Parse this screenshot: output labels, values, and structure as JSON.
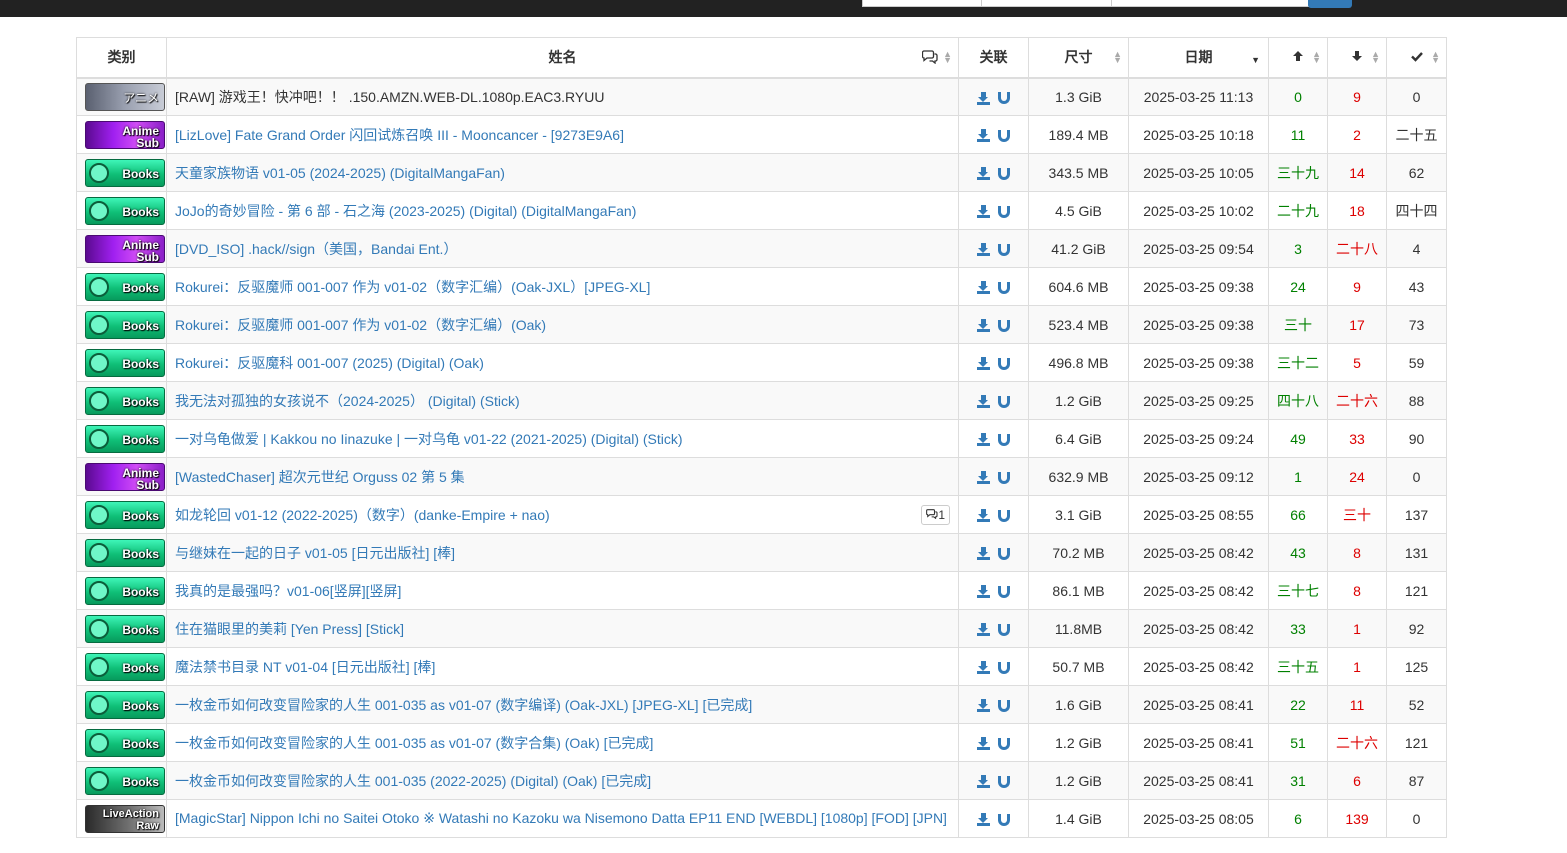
{
  "colors": {
    "accent": "#337ab7",
    "seeders": "#008000",
    "leechers": "#dd0000",
    "topbar": "#222222"
  },
  "table": {
    "headers": {
      "category": "类别",
      "name": "姓名",
      "comments_icon": "comments-icon",
      "links": "关联",
      "size": "尺寸",
      "date": "日期",
      "seeders_icon": "arrow-up-icon",
      "leechers_icon": "arrow-down-icon",
      "completed_icon": "check-icon"
    },
    "rows": [
      {
        "category": "アニメ",
        "cat_class": "cat-raw",
        "name": "[RAW] 游戏王！快冲吧！！ .150.AMZN.WEB-DL.1080p.EAC3.RYUU",
        "comments": "",
        "size": "1.3 GiB",
        "date": "2025-03-25 11:13",
        "seeders": "0",
        "leechers": "9",
        "completed": "0"
      },
      {
        "category": "Anime Sub",
        "cat_class": "cat-sub",
        "name": "[LizLove] Fate Grand Order 闪回试炼召唤 III - Mooncancer - [9273E9A6]",
        "comments": "",
        "size": "189.4 MB",
        "date": "2025-03-25 10:18",
        "seeders": "11",
        "leechers": "2",
        "completed": "二十五"
      },
      {
        "category": "Books",
        "cat_class": "cat-books",
        "name": "天童家族物语 v01-05 (2024-2025) (DigitalMangaFan)",
        "comments": "",
        "size": "343.5 MB",
        "date": "2025-03-25 10:05",
        "seeders": "三十九",
        "leechers": "14",
        "completed": "62"
      },
      {
        "category": "Books",
        "cat_class": "cat-books",
        "name": "JoJo的奇妙冒险 - 第 6 部 - 石之海 (2023-2025) (Digital) (DigitalMangaFan)",
        "comments": "",
        "size": "4.5 GiB",
        "date": "2025-03-25 10:02",
        "seeders": "二十九",
        "leechers": "18",
        "completed": "四十四"
      },
      {
        "category": "Anime Sub",
        "cat_class": "cat-sub",
        "name": "[DVD_ISO] .hack//sign（美国，Bandai Ent.）",
        "comments": "",
        "size": "41.2 GiB",
        "date": "2025-03-25 09:54",
        "seeders": "3",
        "leechers": "二十八",
        "completed": "4"
      },
      {
        "category": "Books",
        "cat_class": "cat-books",
        "name": "Rokurei：反驱魔师 001-007 作为 v01-02（数字汇编）(Oak-JXL）[JPEG-XL]",
        "comments": "",
        "size": "604.6 MB",
        "date": "2025-03-25 09:38",
        "seeders": "24",
        "leechers": "9",
        "completed": "43"
      },
      {
        "category": "Books",
        "cat_class": "cat-books",
        "name": "Rokurei：反驱魔师 001-007 作为 v01-02（数字汇编）(Oak)",
        "comments": "",
        "size": "523.4 MB",
        "date": "2025-03-25 09:38",
        "seeders": "三十",
        "leechers": "17",
        "completed": "73"
      },
      {
        "category": "Books",
        "cat_class": "cat-books",
        "name": "Rokurei：反驱魔科 001-007 (2025) (Digital) (Oak)",
        "comments": "",
        "size": "496.8 MB",
        "date": "2025-03-25 09:38",
        "seeders": "三十二",
        "leechers": "5",
        "completed": "59"
      },
      {
        "category": "Books",
        "cat_class": "cat-books",
        "name": "我无法对孤独的女孩说不（2024-2025） (Digital) (Stick)",
        "comments": "",
        "size": "1.2 GiB",
        "date": "2025-03-25 09:25",
        "seeders": "四十八",
        "leechers": "二十六",
        "completed": "88"
      },
      {
        "category": "Books",
        "cat_class": "cat-books",
        "name": "一对乌龟做爱 | Kakkou no Iinazuke | 一对乌龟 v01-22 (2021-2025) (Digital) (Stick)",
        "comments": "",
        "size": "6.4 GiB",
        "date": "2025-03-25 09:24",
        "seeders": "49",
        "leechers": "33",
        "completed": "90"
      },
      {
        "category": "Anime Sub",
        "cat_class": "cat-sub",
        "name": "[WastedChaser] 超次元世纪 Orguss 02 第 5 集",
        "comments": "",
        "size": "632.9 MB",
        "date": "2025-03-25 09:12",
        "seeders": "1",
        "leechers": "24",
        "completed": "0"
      },
      {
        "category": "Books",
        "cat_class": "cat-books",
        "name": "如龙轮回 v01-12 (2022-2025)（数字）(danke-Empire + nao)",
        "comments": "1",
        "size": "3.1 GiB",
        "date": "2025-03-25 08:55",
        "seeders": "66",
        "leechers": "三十",
        "completed": "137"
      },
      {
        "category": "Books",
        "cat_class": "cat-books",
        "name": "与继妹在一起的日子 v01-05 [日元出版社] [棒]",
        "comments": "",
        "size": "70.2 MB",
        "date": "2025-03-25 08:42",
        "seeders": "43",
        "leechers": "8",
        "completed": "131"
      },
      {
        "category": "Books",
        "cat_class": "cat-books",
        "name": "我真的是最强吗？v01-06[竖屏][竖屏]",
        "comments": "",
        "size": "86.1 MB",
        "date": "2025-03-25 08:42",
        "seeders": "三十七",
        "leechers": "8",
        "completed": "121"
      },
      {
        "category": "Books",
        "cat_class": "cat-books",
        "name": "住在猫眼里的美莉 [Yen Press] [Stick]",
        "comments": "",
        "size": "11.8MB",
        "date": "2025-03-25 08:42",
        "seeders": "33",
        "leechers": "1",
        "completed": "92"
      },
      {
        "category": "Books",
        "cat_class": "cat-books",
        "name": "魔法禁书目录 NT v01-04 [日元出版社] [棒]",
        "comments": "",
        "size": "50.7 MB",
        "date": "2025-03-25 08:42",
        "seeders": "三十五",
        "leechers": "1",
        "completed": "125"
      },
      {
        "category": "Books",
        "cat_class": "cat-books",
        "name": "一枚金币如何改变冒险家的人生 001-035 as v01-07 (数字编译) (Oak-JXL) [JPEG-XL] [已完成]",
        "comments": "",
        "size": "1.6 GiB",
        "date": "2025-03-25 08:41",
        "seeders": "22",
        "leechers": "11",
        "completed": "52"
      },
      {
        "category": "Books",
        "cat_class": "cat-books",
        "name": "一枚金币如何改变冒险家的人生 001-035 as v01-07 (数字合集) (Oak) [已完成]",
        "comments": "",
        "size": "1.2 GiB",
        "date": "2025-03-25 08:41",
        "seeders": "51",
        "leechers": "二十六",
        "completed": "121"
      },
      {
        "category": "Books",
        "cat_class": "cat-books",
        "name": "一枚金币如何改变冒险家的人生 001-035 (2022-2025) (Digital) (Oak) [已完成]",
        "comments": "",
        "size": "1.2 GiB",
        "date": "2025-03-25 08:41",
        "seeders": "31",
        "leechers": "6",
        "completed": "87"
      },
      {
        "category": "LiveAction Raw",
        "cat_class": "cat-live",
        "name": "[MagicStar] Nippon Ichi no Saitei Otoko ※ Watashi no Kazoku wa Nisemono Datta EP11 END [WEBDL] [1080p] [FOD] [JPN]",
        "comments": "",
        "size": "1.4 GiB",
        "date": "2025-03-25 08:05",
        "seeders": "6",
        "leechers": "139",
        "completed": "0"
      }
    ]
  }
}
